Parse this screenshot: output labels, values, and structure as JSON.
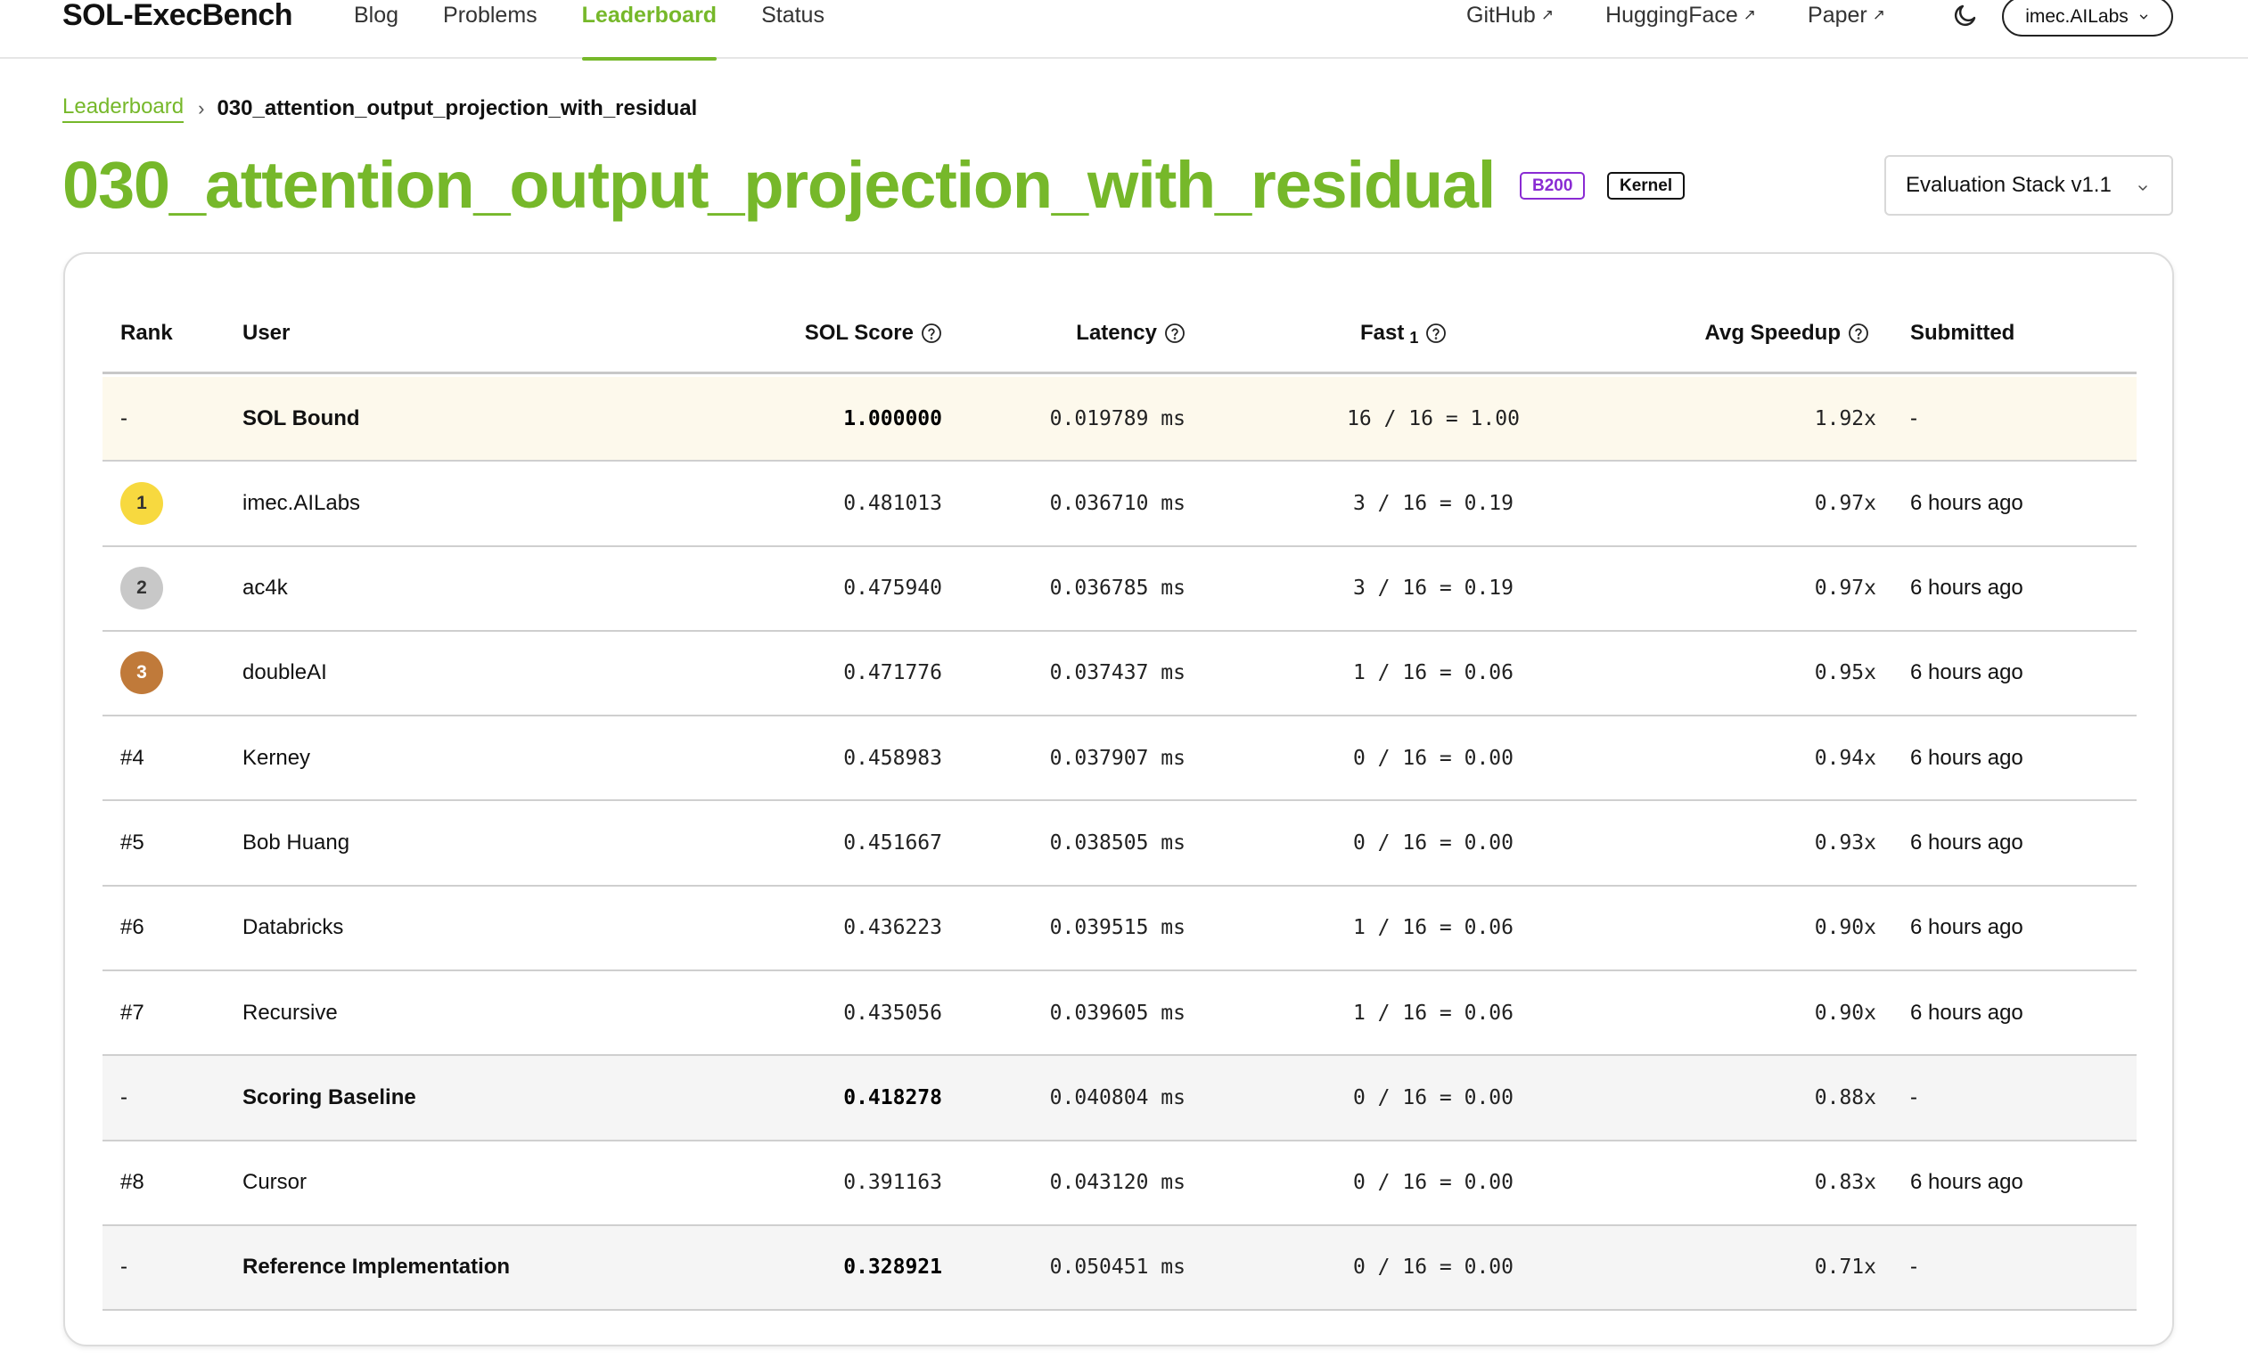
{
  "header": {
    "brand": "SOL-ExecBench",
    "nav": [
      "Blog",
      "Problems",
      "Leaderboard",
      "Status"
    ],
    "external": [
      "GitHub",
      "HuggingFace",
      "Paper"
    ],
    "user": "imec.AILabs"
  },
  "breadcrumb": {
    "root": "Leaderboard",
    "current": "030_attention_output_projection_with_residual"
  },
  "title": "030_attention_output_projection_with_residual",
  "badges": {
    "gpu": "B200",
    "type": "Kernel"
  },
  "stack_select": "Evaluation Stack v1.1",
  "table": {
    "headers": {
      "rank": "Rank",
      "user": "User",
      "sol": "SOL Score",
      "latency": "Latency",
      "fast": "Fast",
      "fast_sub": "1",
      "speedup": "Avg Speedup",
      "submitted": "Submitted"
    },
    "rows": [
      {
        "kind": "sol",
        "rank": "-",
        "medal": "",
        "user": "SOL Bound",
        "sol": "1.000000",
        "latency": "0.019789 ms",
        "fast": "16 / 16 = 1.00",
        "speedup": "1.92x",
        "submitted": "-"
      },
      {
        "kind": "user",
        "rank": "1",
        "medal": "gold",
        "user": "imec.AILabs",
        "sol": "0.481013",
        "latency": "0.036710 ms",
        "fast": "3 / 16 = 0.19",
        "speedup": "0.97x",
        "submitted": "6 hours ago"
      },
      {
        "kind": "user",
        "rank": "2",
        "medal": "silver",
        "user": "ac4k",
        "sol": "0.475940",
        "latency": "0.036785 ms",
        "fast": "3 / 16 = 0.19",
        "speedup": "0.97x",
        "submitted": "6 hours ago"
      },
      {
        "kind": "user",
        "rank": "3",
        "medal": "bronze",
        "user": "doubleAI",
        "sol": "0.471776",
        "latency": "0.037437 ms",
        "fast": "1 / 16 = 0.06",
        "speedup": "0.95x",
        "submitted": "6 hours ago"
      },
      {
        "kind": "user",
        "rank": "#4",
        "medal": "",
        "user": "Kerney",
        "sol": "0.458983",
        "latency": "0.037907 ms",
        "fast": "0 / 16 = 0.00",
        "speedup": "0.94x",
        "submitted": "6 hours ago"
      },
      {
        "kind": "user",
        "rank": "#5",
        "medal": "",
        "user": "Bob Huang",
        "sol": "0.451667",
        "latency": "0.038505 ms",
        "fast": "0 / 16 = 0.00",
        "speedup": "0.93x",
        "submitted": "6 hours ago"
      },
      {
        "kind": "user",
        "rank": "#6",
        "medal": "",
        "user": "Databricks",
        "sol": "0.436223",
        "latency": "0.039515 ms",
        "fast": "1 / 16 = 0.06",
        "speedup": "0.90x",
        "submitted": "6 hours ago"
      },
      {
        "kind": "user",
        "rank": "#7",
        "medal": "",
        "user": "Recursive",
        "sol": "0.435056",
        "latency": "0.039605 ms",
        "fast": "1 / 16 = 0.06",
        "speedup": "0.90x",
        "submitted": "6 hours ago"
      },
      {
        "kind": "base",
        "rank": "-",
        "medal": "",
        "user": "Scoring Baseline",
        "sol": "0.418278",
        "latency": "0.040804 ms",
        "fast": "0 / 16 = 0.00",
        "speedup": "0.88x",
        "submitted": "-"
      },
      {
        "kind": "user",
        "rank": "#8",
        "medal": "",
        "user": "Cursor",
        "sol": "0.391163",
        "latency": "0.043120 ms",
        "fast": "0 / 16 = 0.00",
        "speedup": "0.83x",
        "submitted": "6 hours ago"
      },
      {
        "kind": "base",
        "rank": "-",
        "medal": "",
        "user": "Reference Implementation",
        "sol": "0.328921",
        "latency": "0.050451 ms",
        "fast": "0 / 16 = 0.00",
        "speedup": "0.71x",
        "submitted": "-"
      }
    ]
  },
  "colors": {
    "accent": "#76b82a",
    "gpu_badge": "#8a2bd3",
    "gold": "#f7d93f",
    "silver": "#c8c8c8",
    "bronze": "#c07a3a"
  }
}
